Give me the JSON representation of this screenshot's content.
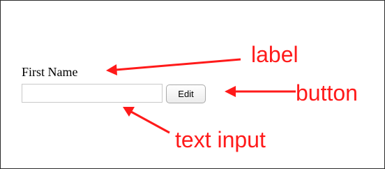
{
  "form": {
    "label": "First Name",
    "input_value": "",
    "input_placeholder": "",
    "button_label": "Edit"
  },
  "annotations": {
    "label": "label",
    "button": "button",
    "text_input": "text input",
    "color": "#ff1a1a"
  }
}
